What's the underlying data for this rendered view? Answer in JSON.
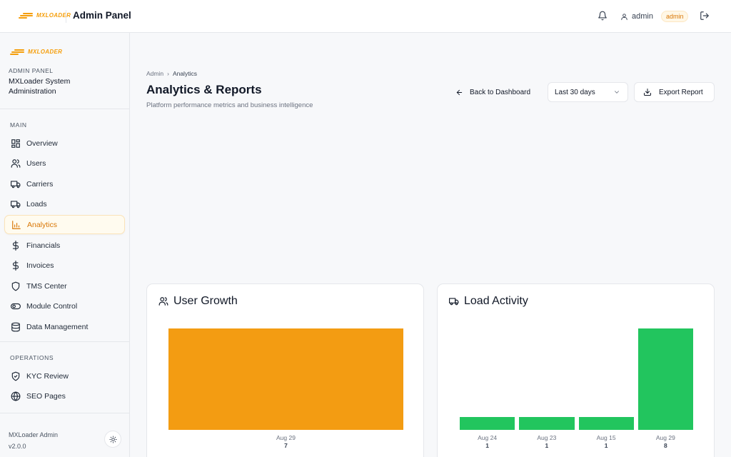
{
  "topbar": {
    "logo_text": "MXLOADER",
    "title": "Admin Panel",
    "username": "admin",
    "role": "admin",
    "icons": [
      "bell-icon",
      "user-icon",
      "logout-icon"
    ]
  },
  "sidebar": {
    "logo_text": "MXLOADER",
    "header_small": "ADMIN PANEL",
    "header_big": "MXLoader System Administration",
    "sections": [
      {
        "label": "MAIN",
        "items": [
          {
            "label": "Overview",
            "icon": "grid-icon"
          },
          {
            "label": "Users",
            "icon": "users-icon"
          },
          {
            "label": "Carriers",
            "icon": "truck-icon"
          },
          {
            "label": "Loads",
            "icon": "truck-icon"
          },
          {
            "label": "Analytics",
            "icon": "bar-chart-icon",
            "active": true
          },
          {
            "label": "Financials",
            "icon": "dollar-icon"
          },
          {
            "label": "Invoices",
            "icon": "dollar-icon"
          },
          {
            "label": "TMS Center",
            "icon": "shield-icon"
          },
          {
            "label": "Module Control",
            "icon": "toggle-icon"
          },
          {
            "label": "Data Management",
            "icon": "database-icon"
          }
        ]
      },
      {
        "label": "OPERATIONS",
        "items": [
          {
            "label": "KYC Review",
            "icon": "shield-check-icon"
          },
          {
            "label": "SEO Pages",
            "icon": "globe-icon"
          }
        ]
      }
    ],
    "footer_name": "MXLoader Admin",
    "footer_version": "v2.0.0"
  },
  "main": {
    "breadcrumb": [
      "Admin",
      "Analytics"
    ],
    "title": "Analytics & Reports",
    "subtitle": "Platform performance metrics and business intelligence",
    "back_label": "Back to Dashboard",
    "range_value": "Last 30 days",
    "export_label": "Export Report"
  },
  "colors": {
    "accent": "#f59e0b",
    "success": "#22c55e"
  },
  "chart_data": [
    {
      "type": "bar",
      "title": "User Growth",
      "categories": [
        "Aug 29"
      ],
      "values": [
        7
      ],
      "color": "#f39c12"
    },
    {
      "type": "bar",
      "title": "Load Activity",
      "categories": [
        "Aug 24",
        "Aug 23",
        "Aug 15",
        "Aug 29"
      ],
      "values": [
        1,
        1,
        1,
        8
      ],
      "color": "#22c55e"
    }
  ]
}
